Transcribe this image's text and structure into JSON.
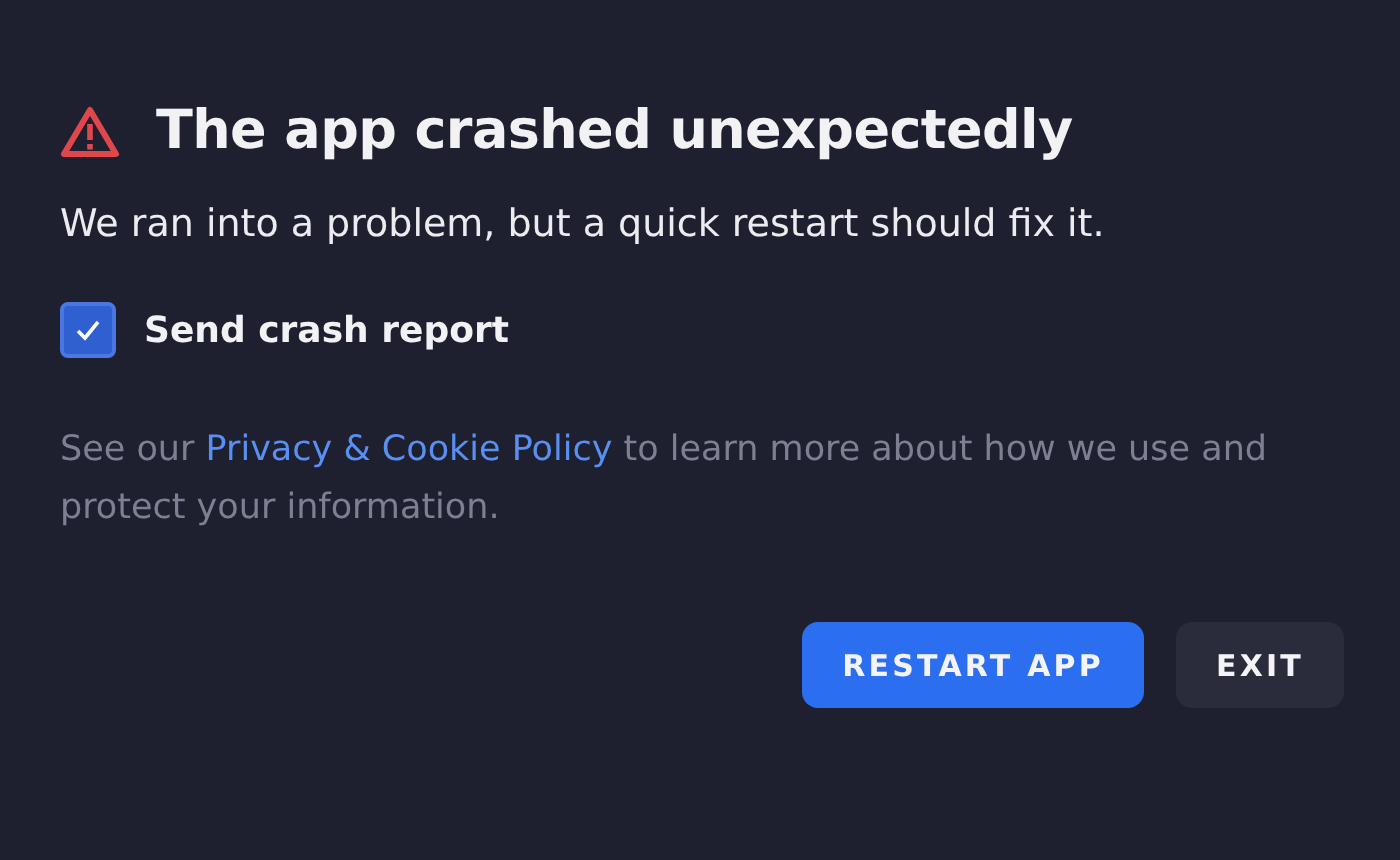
{
  "dialog": {
    "title": "The app crashed unexpectedly",
    "message": "We ran into a problem, but a quick restart should fix it.",
    "checkbox": {
      "label": "Send crash report",
      "checked": true
    },
    "policy": {
      "before": "See our ",
      "link": "Privacy & Cookie Policy",
      "after": " to learn more about how we use and protect your information."
    },
    "buttons": [
      {
        "label": "RESTART APP",
        "kind": "primary"
      },
      {
        "label": "EXIT",
        "kind": "secondary"
      }
    ]
  }
}
